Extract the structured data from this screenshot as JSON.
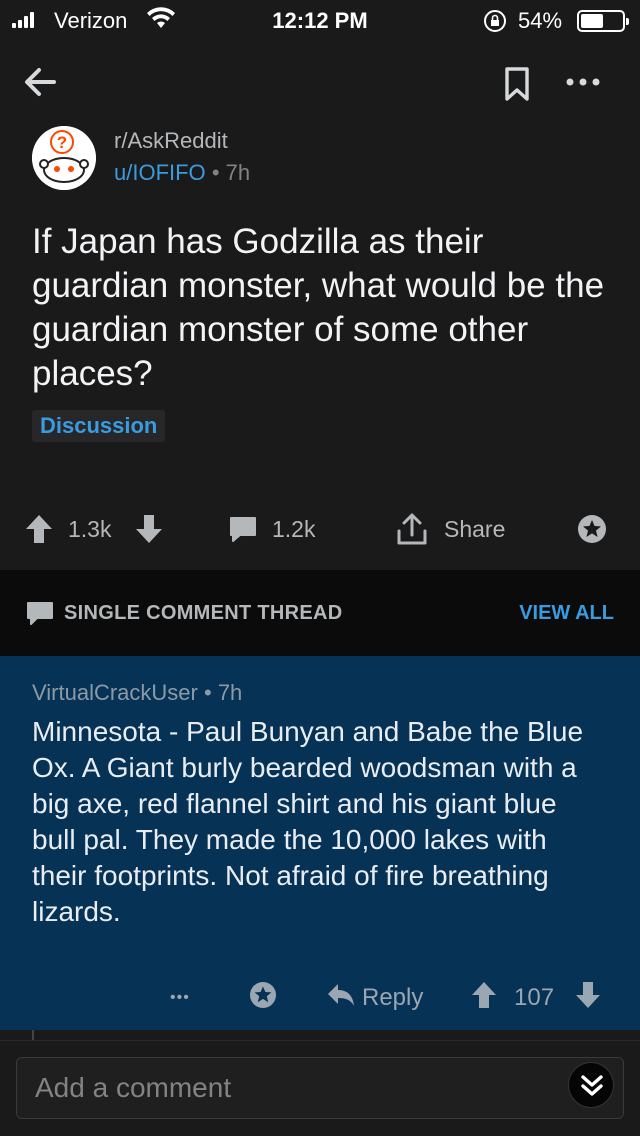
{
  "status_bar": {
    "carrier": "Verizon",
    "time": "12:12 PM",
    "battery_percent": "54%",
    "battery_level": 0.54
  },
  "post": {
    "subreddit": "r/AskReddit",
    "author": "u/IOFIFO",
    "separator": "•",
    "age": "7h",
    "title": "If Japan has Godzilla as their guardian monster, what would be the guardian monster of some other places?",
    "flair": "Discussion",
    "upvotes": "1.3k",
    "comments": "1.2k",
    "share_label": "Share"
  },
  "thread_bar": {
    "label": "SINGLE COMMENT THREAD",
    "view_all": "VIEW ALL"
  },
  "comment": {
    "author": "VirtualCrackUser",
    "separator": "•",
    "age": "7h",
    "body": "Minnesota - Paul Bunyan and Babe the Blue Ox. A Giant burly bearded woodsman with a big axe, red flannel shirt and his giant blue bull pal. They made the 10,000 lakes with their footprints. Not afraid of fire breathing lizards.",
    "more": "•••",
    "reply_label": "Reply",
    "score": "107"
  },
  "composer": {
    "placeholder": "Add a comment"
  },
  "colors": {
    "background": "#1a1a1b",
    "accent_blue": "#3a9ce0",
    "comment_highlight": "#063255",
    "thread_bar": "#0b0b0b"
  },
  "icons": [
    "back-arrow-icon",
    "bookmark-icon",
    "more-icon",
    "upvote-icon",
    "downvote-icon",
    "comment-icon",
    "share-icon",
    "award-icon",
    "reply-icon",
    "collapse-icon"
  ]
}
